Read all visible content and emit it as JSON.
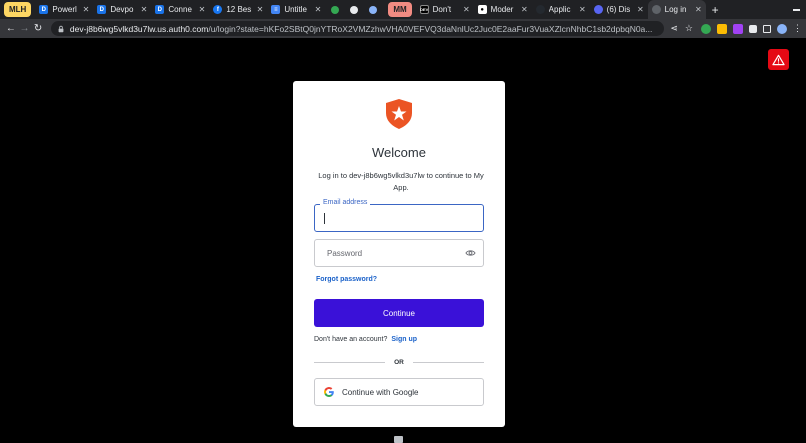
{
  "browser": {
    "tab_group_1": "MLH",
    "tab_group_2": "MM",
    "tabs": [
      {
        "title": "Powerl",
        "icon": "devpost-icon"
      },
      {
        "title": "Devpo",
        "icon": "devpost-icon"
      },
      {
        "title": "Conne",
        "icon": "devpost-icon"
      },
      {
        "title": "12 Bes",
        "icon": "facebook-icon"
      },
      {
        "title": "Untitle",
        "icon": "docs-icon"
      },
      {
        "title": "Don't",
        "icon": "dev-icon"
      },
      {
        "title": "Moder",
        "icon": "medium-icon"
      },
      {
        "title": "Applic",
        "icon": "github-icon"
      },
      {
        "title": "(6) Dis",
        "icon": "discord-icon"
      },
      {
        "title": "Log in",
        "icon": "auth0-icon"
      }
    ],
    "url_host": "dev-j8b6wg5vlkd3u7lw.us.auth0.com",
    "url_rest": "/u/login?state=hKFo2SBtQ0jnYTRoX2VMZzhwVHA0VEFVQ3daNnlUc2Juc0E2aaFur3VuaXZlcnNhbC1sb2dpbqN0a...",
    "colors": {
      "tab_group_1": "#fdd663",
      "tab_group_2": "#f28b82",
      "frame": "#202124",
      "toolbar": "#35363a"
    }
  },
  "login": {
    "title": "Welcome",
    "description": "Log in to dev-j8b6wg5vlkd3u7lw to continue to My App.",
    "email_label": "Email address",
    "email_value": "",
    "password_placeholder": "Password",
    "forgot_password": "Forgot password?",
    "continue_label": "Continue",
    "no_account_text": "Don't have an account?",
    "signup_label": "Sign up",
    "divider_text": "OR",
    "google_label": "Continue with Google",
    "colors": {
      "primary": "#3a11d8",
      "link": "#1a61c9",
      "focus": "#3b66c4",
      "logo": "#eb5424"
    }
  }
}
